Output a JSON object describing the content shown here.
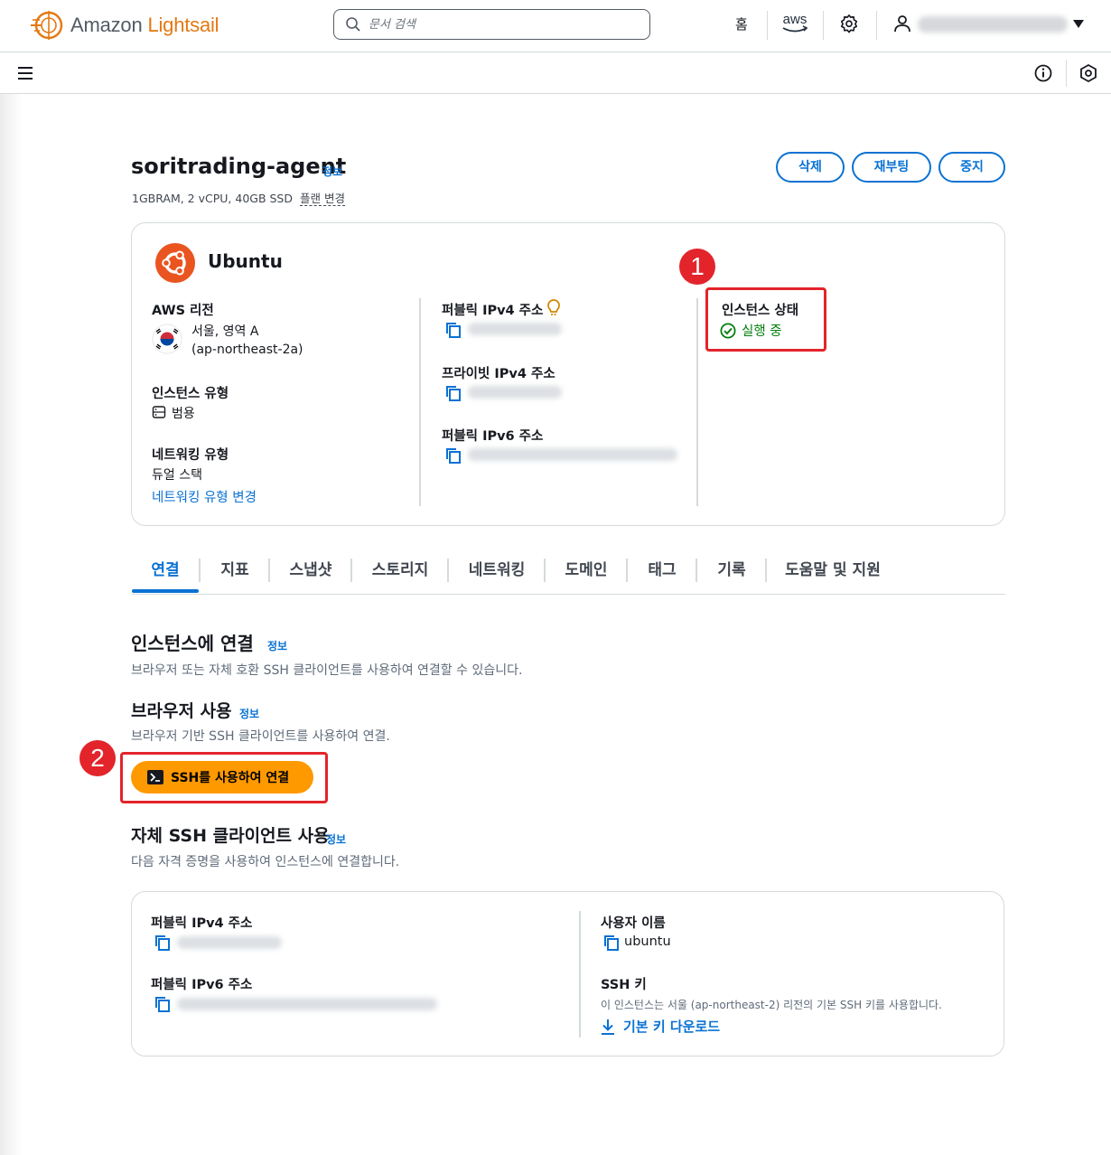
{
  "brand": {
    "name_part1": "Amazon",
    "name_part2": "Lightsail",
    "accent": "#e47911"
  },
  "topbar": {
    "search_placeholder": "문서 검색",
    "home_label": "홈",
    "aws_label": "aws",
    "icons": [
      "search-icon",
      "aws-logo-icon",
      "gear-icon",
      "user-icon",
      "caret-down-icon"
    ]
  },
  "subbar": {
    "icons": [
      "hamburger-icon",
      "info-icon",
      "hexagon-icon"
    ]
  },
  "instance": {
    "name": "soritrading-agent",
    "info_label": "정보",
    "spec": "1GBRAM, 2 vCPU, 40GB SSD",
    "plan_change": "플랜 변경",
    "actions": {
      "delete": "삭제",
      "reboot": "재부팅",
      "stop": "중지"
    }
  },
  "summary": {
    "os": "Ubuntu",
    "region_label": "AWS 리전",
    "region_value1": "서울, 영역 A",
    "region_value2": "(ap-northeast-2a)",
    "instance_type_label": "인스턴스 유형",
    "instance_type_value": "범용",
    "network_type_label": "네트워킹 유형",
    "network_type_value": "듀얼 스택",
    "network_type_change": "네트워킹 유형 변경",
    "public_ipv4_label": "퍼블릭 IPv4 주소",
    "private_ipv4_label": "프라이빗 IPv4 주소",
    "public_ipv6_label": "퍼블릭 IPv6 주소",
    "status_label": "인스턴스 상태",
    "status_value": "실행 중",
    "status_color": "#037f0c"
  },
  "annotations": {
    "badge1": "1",
    "badge2": "2",
    "highlight_color": "#e3242b"
  },
  "tabs": [
    {
      "label": "연결"
    },
    {
      "label": "지표"
    },
    {
      "label": "스냅샷"
    },
    {
      "label": "스토리지"
    },
    {
      "label": "네트워킹"
    },
    {
      "label": "도메인"
    },
    {
      "label": "태그"
    },
    {
      "label": "기록"
    },
    {
      "label": "도움말 및 지원"
    }
  ],
  "connect": {
    "title": "인스턴스에 연결",
    "info_label": "정보",
    "desc": "브라우저 또는 자체 호환 SSH 클라이언트를 사용하여 연결할 수 있습니다.",
    "browser_title": "브라우저 사용",
    "browser_info": "정보",
    "browser_desc": "브라우저 기반 SSH 클라이언트를 사용하여 연결.",
    "ssh_button": "SSH를 사용하여 연결",
    "own_title": "자체 SSH 클라이언트 사용",
    "own_info": "정보",
    "own_desc": "다음 자격 증명을 사용하여 인스턴스에 연결합니다.",
    "public_ipv4_label": "퍼블릭 IPv4 주소",
    "public_ipv6_label": "퍼블릭 IPv6 주소",
    "username_label": "사용자 이름",
    "username_value": "ubuntu",
    "ssh_key_label": "SSH 키",
    "ssh_key_desc": "이 인스턴스는 서울 (ap-northeast-2) 리전의 기본 SSH 키를 사용합니다.",
    "download_link": "기본 키 다운로드"
  }
}
